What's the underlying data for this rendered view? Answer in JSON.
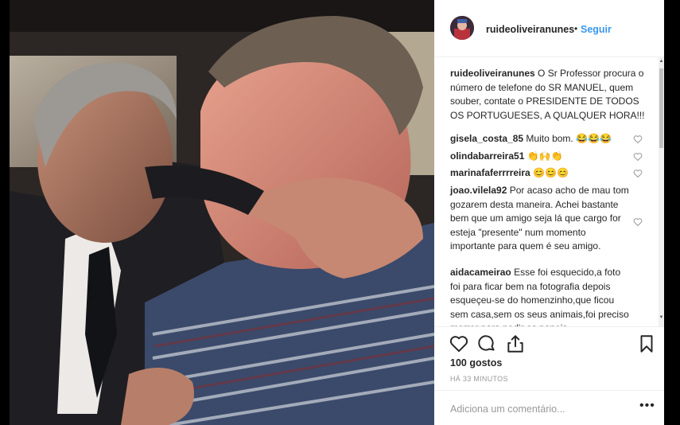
{
  "post": {
    "username": "ruideoliveiranunes",
    "separator": "•",
    "follow_label": "Seguir",
    "caption": "O Sr Professor procura o número de telefone do SR MANUEL, quem souber, contate o PRESIDENTE DE TODOS OS PORTUGUESES, A QUALQUER HORA!!!"
  },
  "comments": [
    {
      "user": "gisela_costa_85",
      "text": "Muito bom. 😂😂😂"
    },
    {
      "user": "olindabarreira51",
      "text": "👏🙌👏"
    },
    {
      "user": "marinafaferrrreira",
      "text": "😊😊😊"
    },
    {
      "user": "joao.vilela92",
      "text": "Por acaso acho de mau tom gozarem desta maneira. Achei bastante bem que um amigo seja lá que cargo for esteja \"presente\" num momento importante para quem é seu amigo."
    },
    {
      "user": "aidacameirao",
      "text": "Esse foi esquecido,a foto foi para ficar bem na fotografia depois esqueçeu-se do homenzinho,que ficou sem casa,sem os seus animais,foi preciso morrer para pedir os papeis"
    }
  ],
  "likes": "100 gostos",
  "time_ago": "HÁ 33 MINUTOS",
  "add_comment_placeholder": "Adiciona um comentário...",
  "more_label": "•••",
  "colors": {
    "link": "#3897f0",
    "text": "#262626",
    "muted": "#999999"
  }
}
